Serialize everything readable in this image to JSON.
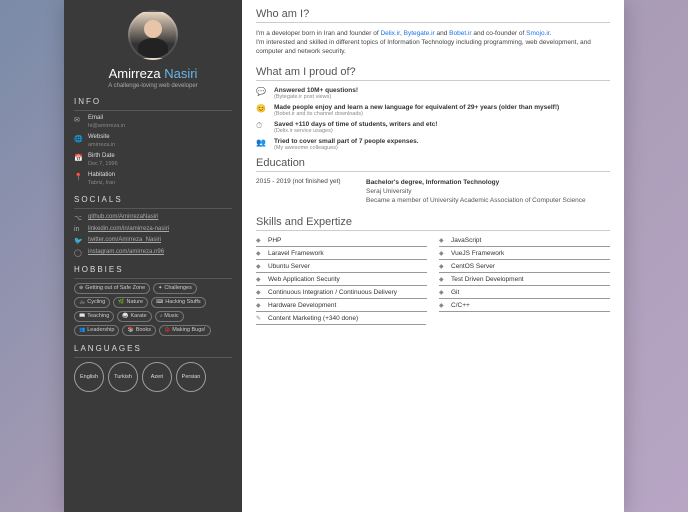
{
  "name_first": "Amirreza",
  "name_last": "Nasiri",
  "tagline": "A challenge-loving web developer",
  "sections": {
    "info": "INFO",
    "socials": "SOCIALS",
    "hobbies": "HOBBIES",
    "languages": "LANGUAGES"
  },
  "info": [
    {
      "label": "Email",
      "val": "hi@amirreza.in"
    },
    {
      "label": "Website",
      "val": "amirreza.in"
    },
    {
      "label": "Birth Date",
      "val": "Dec 7, 1996"
    },
    {
      "label": "Habitation",
      "val": "Tabriz, Iran"
    }
  ],
  "socials": [
    {
      "t": "github.com/AmirrezaNasiri"
    },
    {
      "t": "linkedin.com/in/amirreza-nasiri"
    },
    {
      "t": "twitter.com/Amirreza_Nasiri"
    },
    {
      "t": "instagram.com/amirreza.n96"
    }
  ],
  "hobbies": [
    "Getting out of Safe Zone",
    "Challenges",
    "Cycling",
    "Nature",
    "Hacking Stuffs",
    "Teaching",
    "Karate",
    "Music",
    "Leadership",
    "Books",
    "Making Bugs!"
  ],
  "languages": [
    "English",
    "Turkish",
    "Azeri",
    "Persian"
  ],
  "main": {
    "who_h": "Who am I?",
    "who_t1": "I'm a developer born in Iran and founder of ",
    "who_links": [
      "Delix.ir",
      "Bytegate.ir",
      "Bobet.ir",
      "Smojo.ir"
    ],
    "who_and": " and ",
    "who_comma": ", ",
    "who_co": " and co-founder of ",
    "who_dot": ".",
    "who_t2": "I'm interested and skilled in different topics of Information Technology including programming, web development, and computer and network security.",
    "proud_h": "What am I proud of?",
    "proud": [
      {
        "t": "Answered 10M+ questions!",
        "s": "(Bytegate.ir post views)"
      },
      {
        "t": "Made people enjoy and learn a new language for equivalent of 29+ years (older than myself!)",
        "s": "(Bobet.ir and its channel downloads)"
      },
      {
        "t": "Saved +110 days of time of students, writers and etc!",
        "s": "(Delix.ir service usages)"
      },
      {
        "t": "Tried to cover small part of 7 people expenses.",
        "s": "(My awesome colleagues)"
      }
    ],
    "edu_h": "Education",
    "edu_date": "2015 - 2019 (not finished yet)",
    "edu_title": "Bachelor's degree, Information Technology",
    "edu_uni": "Seraj University",
    "edu_extra": "Became a member of University Academic Association of Computer Science",
    "skills_h": "Skills and Expertize",
    "skills_l": [
      "PHP",
      "Laravel Framework",
      "Ubuntu Server",
      "Web Application Security",
      "Continuous Integration / Continuous Delivery",
      "Hardware Development"
    ],
    "skills_r": [
      "JavaScript",
      "VueJS Framework",
      "CentOS Server",
      "Test Driven Development",
      "Git",
      "C/C++"
    ],
    "skill_last": "Content Marketing (+340 done)"
  }
}
